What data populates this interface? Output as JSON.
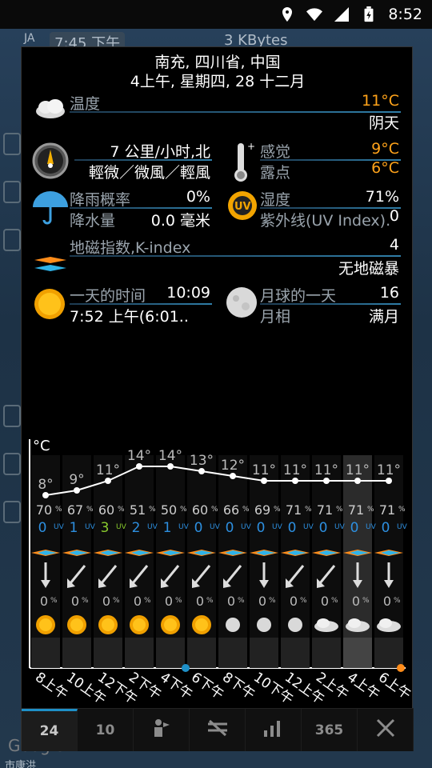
{
  "status_bar": {
    "time": "8:52",
    "icons": [
      "location-icon",
      "wifi-icon",
      "signal-icon",
      "battery-icon"
    ]
  },
  "map_bg": {
    "clock_text": "7:45 下午",
    "kbytes": "3 KBytes",
    "google": "Google",
    "top_left": "JA",
    "bottom_left": "市康洪"
  },
  "header": {
    "location": "南充, 四川省, 中国",
    "datetime": "4上午, 星期四, 28 十二月"
  },
  "current": {
    "temperature_label": "温度",
    "temperature_value": "11°C",
    "condition": "阴天",
    "wind_speed": "7 公里/小时,北",
    "wind_desc": "輕微／微風／輕風",
    "feels_label": "感觉",
    "feels_value": "9°C",
    "dew_label": "露点",
    "dew_value": "6°C",
    "rain_prob_label": "降雨概率",
    "rain_prob_value": "0%",
    "precip_label": "降水量",
    "precip_value": "0.0 毫米",
    "humidity_label": "湿度",
    "humidity_value": "71%",
    "uv_label": "紫外线(UV Index).",
    "uv_value": "0",
    "kindex_label": "地磁指数,K-index",
    "kindex_value": "4",
    "kindex_desc": "无地磁暴",
    "daylen_label": "一天的时间",
    "daylen_value": "10:09",
    "sunrise": "7:52 上午(6:01..",
    "moon_day_label": "月球的一天",
    "moon_day_value": "16",
    "moon_phase_label": "月相",
    "moon_phase_value": "满月"
  },
  "chart_data": {
    "type": "line",
    "ylabel": "°C",
    "x": [
      "8上午",
      "10上午",
      "12下午",
      "2下午",
      "4下午",
      "6下午",
      "8下午",
      "10下午",
      "12上午",
      "2上午",
      "4上午",
      "6上午"
    ],
    "temps": [
      8,
      9,
      11,
      14,
      14,
      13,
      12,
      11,
      11,
      11,
      11,
      11
    ],
    "humidity": [
      70,
      67,
      60,
      51,
      50,
      60,
      66,
      69,
      71,
      71,
      71,
      71
    ],
    "uv": [
      0,
      1,
      3,
      2,
      1,
      0,
      0,
      0,
      0,
      0,
      0,
      0
    ],
    "precip_prob": [
      0,
      0,
      0,
      0,
      0,
      0,
      0,
      0,
      0,
      0,
      0,
      0
    ],
    "weather_icons": [
      "sun-icon",
      "sun-icon",
      "sun-icon",
      "sun-icon",
      "sun-icon",
      "sun-icon",
      "moon-icon",
      "moon-icon",
      "moon-icon",
      "cloud-night-icon",
      "cloud-night-icon",
      "cloud-night-icon"
    ],
    "wind_dirs": [
      "S",
      "SW",
      "SW",
      "SW",
      "SW",
      "SW",
      "SW",
      "S",
      "SW",
      "SW",
      "S",
      "S"
    ],
    "highlight_index": 10
  },
  "tabs": [
    {
      "label": "24",
      "icon": ""
    },
    {
      "label": "10",
      "icon": ""
    },
    {
      "label": "",
      "icon": "person-icon"
    },
    {
      "label": "",
      "icon": "no-signal-icon"
    },
    {
      "label": "",
      "icon": "chart-icon"
    },
    {
      "label": "365",
      "icon": ""
    },
    {
      "label": "",
      "icon": "close-icon"
    }
  ],
  "colors": {
    "orange": "#ffa31a",
    "uv_green": "#8acc2e",
    "humidity_blue": "#2d8fe0",
    "accent": "#1e90c8"
  }
}
